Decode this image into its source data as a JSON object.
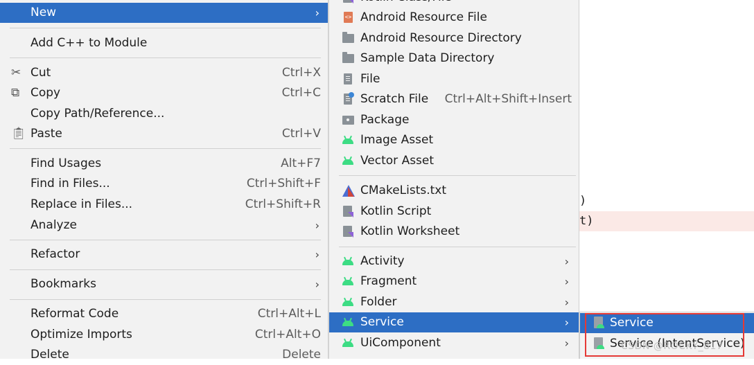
{
  "code": {
    "line1": ")",
    "line2": "t)"
  },
  "main_menu": {
    "items": [
      {
        "label": "New",
        "arrow": "›"
      },
      {
        "label": "Add C++ to Module"
      },
      {
        "label": "Cut",
        "shortcut": "Ctrl+X",
        "icon": "scissors-icon"
      },
      {
        "label": "Copy",
        "shortcut": "Ctrl+C",
        "icon": "copy-icon"
      },
      {
        "label": "Copy Path/Reference..."
      },
      {
        "label": "Paste",
        "shortcut": "Ctrl+V",
        "icon": "clipboard-icon"
      },
      {
        "label": "Find Usages",
        "shortcut": "Alt+F7"
      },
      {
        "label": "Find in Files...",
        "shortcut": "Ctrl+Shift+F"
      },
      {
        "label": "Replace in Files...",
        "shortcut": "Ctrl+Shift+R"
      },
      {
        "label": "Analyze",
        "arrow": "›"
      },
      {
        "label": "Refactor",
        "arrow": "›"
      },
      {
        "label": "Bookmarks",
        "arrow": "›"
      },
      {
        "label": "Reformat Code",
        "shortcut": "Ctrl+Alt+L"
      },
      {
        "label": "Optimize Imports",
        "shortcut": "Ctrl+Alt+O"
      },
      {
        "label": "Delete",
        "shortcut": "Delete"
      }
    ]
  },
  "new_menu": {
    "items": [
      {
        "label": "Kotlin Class/File"
      },
      {
        "label": "Android Resource File",
        "icon": "android-resource-file-icon"
      },
      {
        "label": "Android Resource Directory",
        "icon": "folder-icon"
      },
      {
        "label": "Sample Data Directory",
        "icon": "folder-icon"
      },
      {
        "label": "File",
        "icon": "file-icon"
      },
      {
        "label": "Scratch File",
        "shortcut": "Ctrl+Alt+Shift+Insert",
        "icon": "scratch-file-icon"
      },
      {
        "label": "Package",
        "icon": "package-icon"
      },
      {
        "label": "Image Asset",
        "icon": "android-icon"
      },
      {
        "label": "Vector Asset",
        "icon": "android-icon"
      },
      {
        "label": "CMakeLists.txt",
        "icon": "cmake-icon"
      },
      {
        "label": "Kotlin Script",
        "icon": "kotlin-script-icon"
      },
      {
        "label": "Kotlin Worksheet",
        "icon": "kotlin-worksheet-icon"
      },
      {
        "label": "Activity",
        "arrow": "›",
        "icon": "android-icon"
      },
      {
        "label": "Fragment",
        "arrow": "›",
        "icon": "android-icon"
      },
      {
        "label": "Folder",
        "arrow": "›",
        "icon": "android-icon"
      },
      {
        "label": "Service",
        "arrow": "›",
        "icon": "android-icon"
      },
      {
        "label": "UiComponent",
        "arrow": "›",
        "icon": "android-icon"
      }
    ]
  },
  "service_menu": {
    "items": [
      {
        "label": "Service",
        "icon": "service-icon"
      },
      {
        "label": "Service (IntentService)",
        "icon": "service-icon"
      }
    ]
  },
  "watermark": "CSDN @ROCKY_817",
  "colors": {
    "selection": "#2d6ec4",
    "menu_bg": "#f2f2f2",
    "highlight_box": "#e53935",
    "android_green": "#3ddc84"
  }
}
